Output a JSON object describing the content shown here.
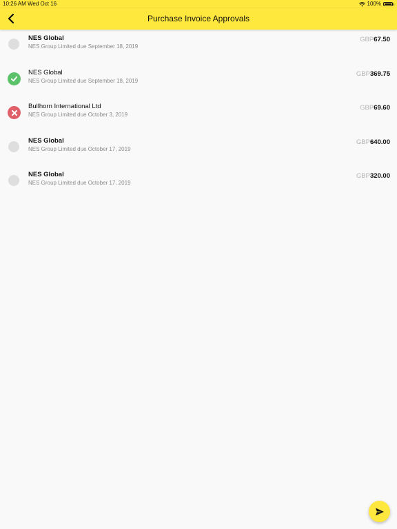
{
  "status_bar": {
    "time": "10:26 AM",
    "date": "Wed Oct 16",
    "battery": "100%"
  },
  "navbar": {
    "title": "Purchase Invoice Approvals",
    "back_icon": "chevron-left-icon"
  },
  "invoices": [
    {
      "supplier": "NES Global",
      "detail": "NES Group Limited due September 18, 2019",
      "currency": "GBP",
      "amount": "67.50",
      "status": "pending"
    },
    {
      "supplier": "NES Global",
      "detail": "NES Group Limited due September 18, 2019",
      "currency": "GBP",
      "amount": "369.75",
      "status": "approved"
    },
    {
      "supplier": "Bullhorn International Ltd",
      "detail": "NES Group Limited due October 3, 2019",
      "currency": "GBP",
      "amount": "69.60",
      "status": "rejected"
    },
    {
      "supplier": "NES Global",
      "detail": "NES Group Limited due October 17, 2019",
      "currency": "GBP",
      "amount": "640.00",
      "status": "pending"
    },
    {
      "supplier": "NES Global",
      "detail": "NES Group Limited due October 17, 2019",
      "currency": "GBP",
      "amount": "320.00",
      "status": "pending"
    }
  ],
  "fab": {
    "icon": "send-icon"
  },
  "colors": {
    "accent": "#ffe83d",
    "approved": "#5cc26a",
    "rejected": "#e0606a",
    "pending": "#dedede"
  }
}
